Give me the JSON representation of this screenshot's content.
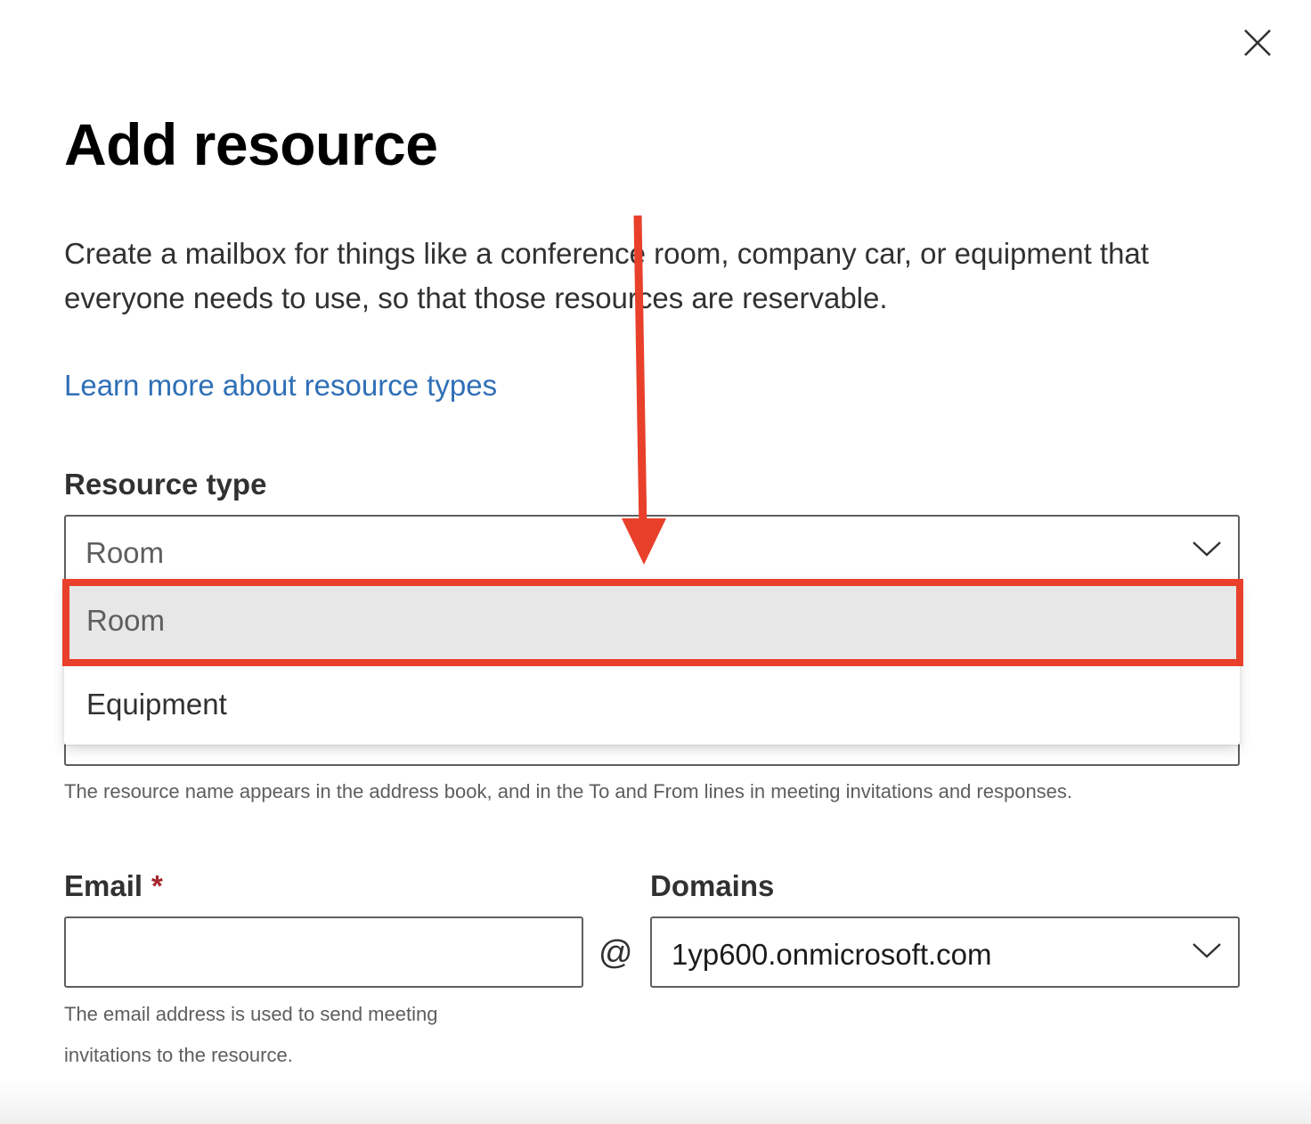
{
  "dialog": {
    "title": "Add resource",
    "description": "Create a mailbox for things like a conference room, company car, or equipment that everyone needs to use, so that those resources are reservable.",
    "learn_more_link": "Learn more about resource types"
  },
  "resource_type": {
    "label": "Resource type",
    "selected": "Room",
    "options": [
      "Room",
      "Equipment"
    ]
  },
  "name_field": {
    "hint": "The resource name appears in the address book, and in the To and From lines in meeting invitations and responses."
  },
  "email": {
    "label": "Email",
    "required_marker": "*",
    "value": "",
    "at_sign": "@",
    "hint": "The email address is used to send meeting invitations to the resource."
  },
  "domains": {
    "label": "Domains",
    "selected": "1yp600.onmicrosoft.com"
  },
  "icons": {
    "close": "close-icon",
    "chevron": "chevron-down-icon"
  },
  "annotation": {
    "color": "#e8402b"
  }
}
